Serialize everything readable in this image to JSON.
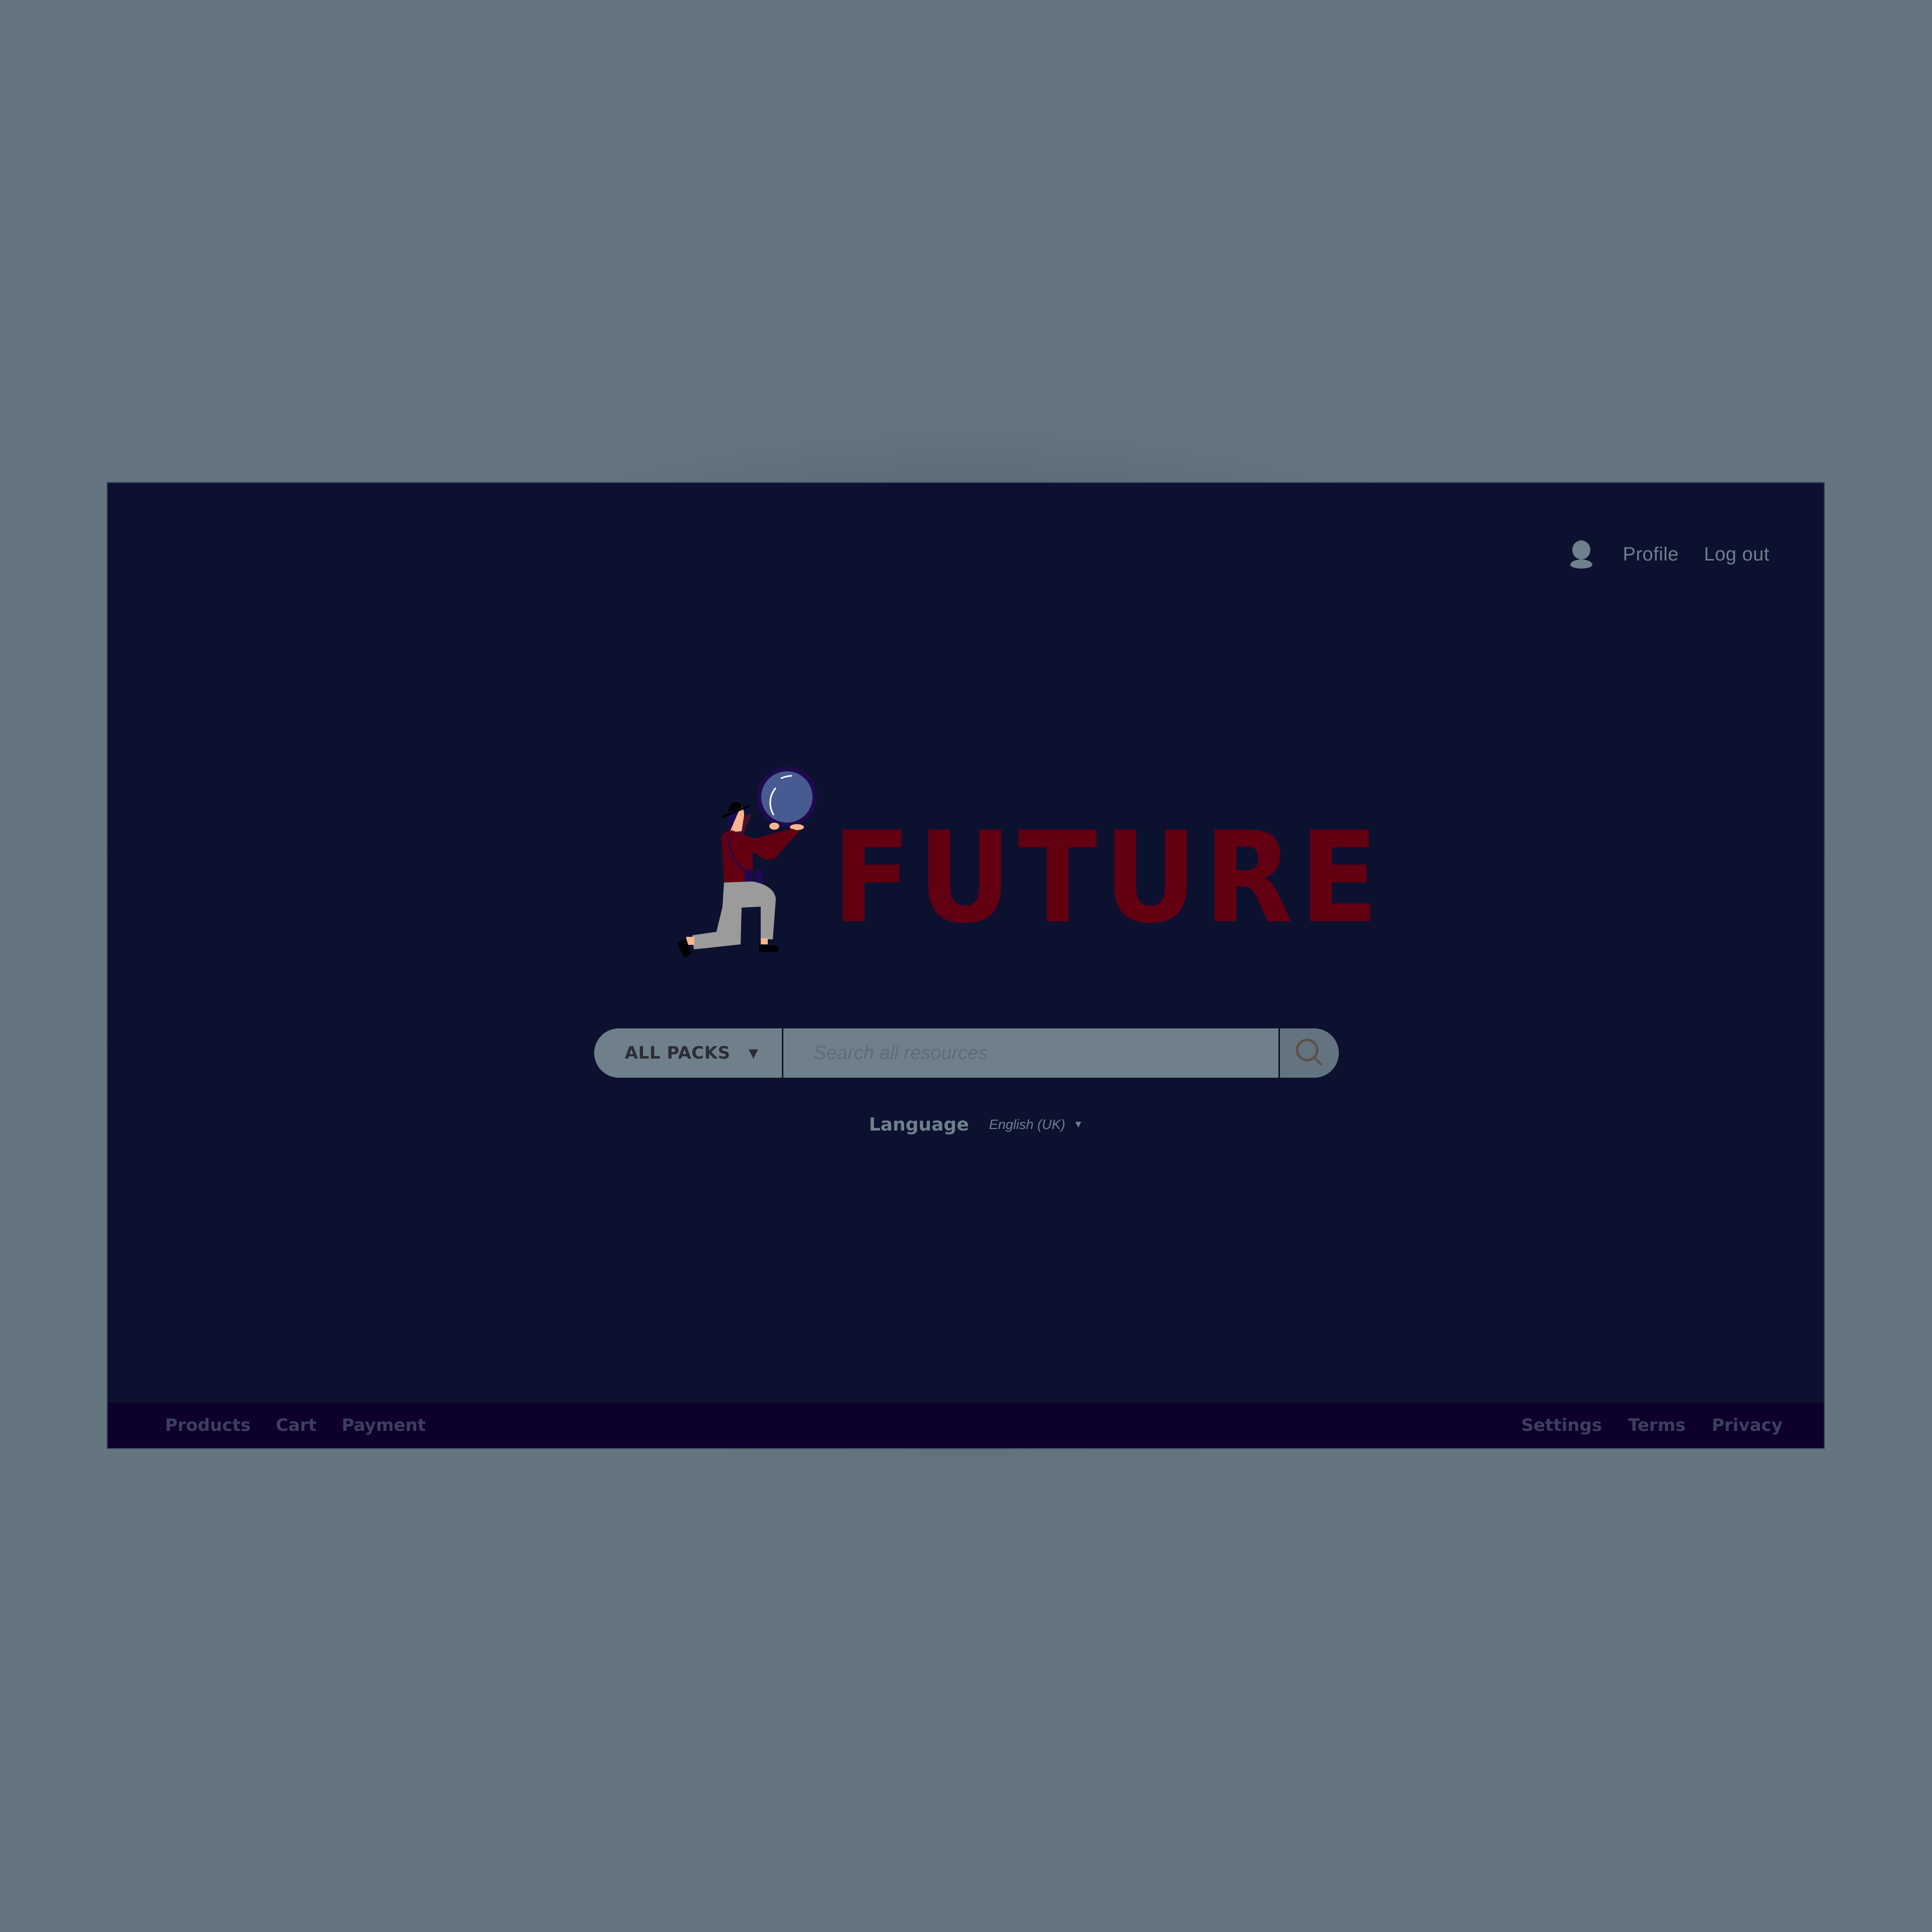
{
  "header": {
    "profile_icon": "user-icon",
    "profile_label": "Profile",
    "logout_label": "Log out"
  },
  "logo": {
    "text": "FUTURE",
    "illustration": "kneeling-explorer-with-magnifying-glass",
    "text_color": "#620012"
  },
  "search": {
    "category_label": "ALL PACKS",
    "category_icon": "caret-down-icon",
    "value": "",
    "placeholder": "Search all resources",
    "button_icon": "search-icon"
  },
  "language": {
    "label": "Language",
    "selected": "English (UK)",
    "dropdown_icon": "caret-down-icon"
  },
  "footer": {
    "left_links": [
      "Products",
      "Cart",
      "Payment"
    ],
    "right_links": [
      "Settings",
      "Terms",
      "Privacy"
    ]
  },
  "colors": {
    "window_bg": "#0c1130",
    "footer_bg": "#0d002b",
    "page_bg": "#64757f",
    "muted_text": "#6e808b",
    "search_bg": "#6f808a",
    "search_icon": "#5e5049"
  }
}
